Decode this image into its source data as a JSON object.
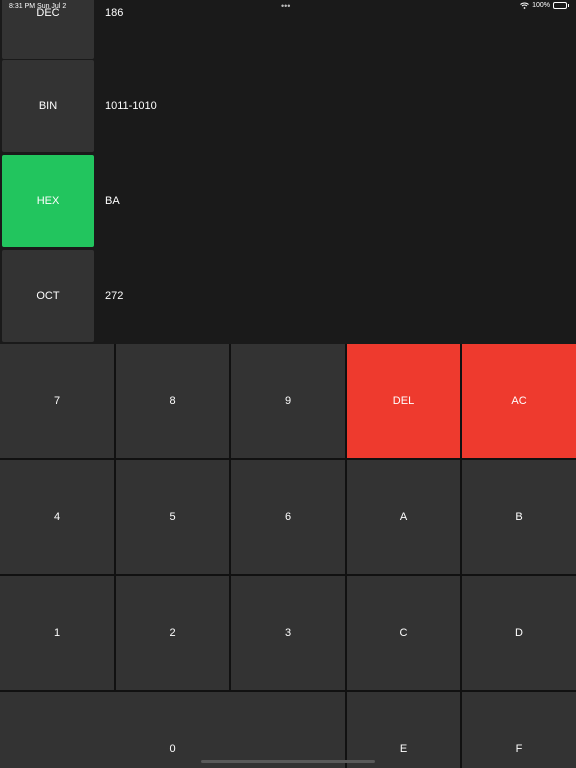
{
  "status_bar": {
    "time": "8:31 PM",
    "date": "Sun Jul 2",
    "battery": "100%",
    "wifi_icon": "wifi-icon",
    "battery_icon": "battery-icon"
  },
  "colors": {
    "active_base": "#22c55e",
    "danger": "#ee3a2e",
    "key": "#333333",
    "display_bg": "#1a1a1a"
  },
  "display": {
    "rows": [
      {
        "label": "DEC",
        "value": "186",
        "active": false
      },
      {
        "label": "BIN",
        "value": "1011-1010",
        "active": false
      },
      {
        "label": "HEX",
        "value": "BA",
        "active": true
      },
      {
        "label": "OCT",
        "value": "272",
        "active": false
      }
    ]
  },
  "keypad": {
    "k7": "7",
    "k8": "8",
    "k9": "9",
    "del": "DEL",
    "ac": "AC",
    "k4": "4",
    "k5": "5",
    "k6": "6",
    "kA": "A",
    "kB": "B",
    "k1": "1",
    "k2": "2",
    "k3": "3",
    "kC": "C",
    "kD": "D",
    "k0": "0",
    "kE": "E",
    "kF": "F"
  }
}
